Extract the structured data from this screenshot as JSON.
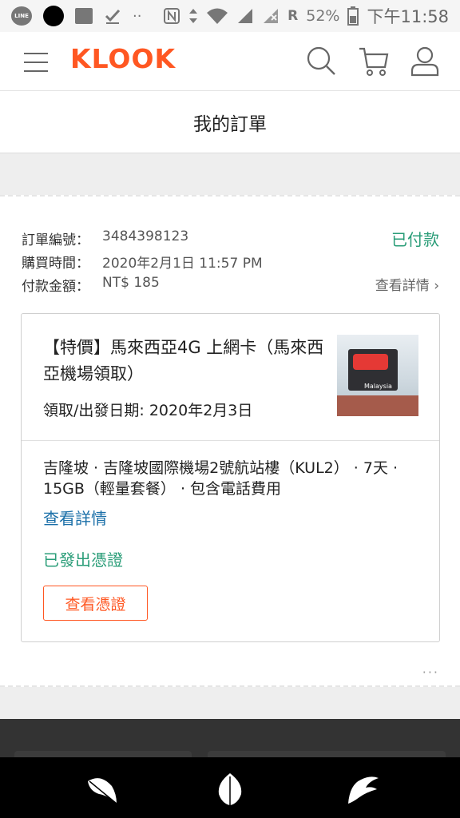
{
  "status_bar": {
    "line_label": "LINE",
    "signal_r": "R",
    "battery": "52%",
    "time": "下午11:58"
  },
  "header": {
    "logo": "KLOOK",
    "icons": [
      "menu-icon",
      "search-icon",
      "cart-icon",
      "user-icon"
    ]
  },
  "page": {
    "title": "我的訂單"
  },
  "order": {
    "number_label": "訂單編號：",
    "number": "3484398123",
    "purchase_time_label": "購買時間：",
    "purchase_time": "2020年2月1日 11:57 PM",
    "amount_label": "付款金額：",
    "amount": "NT$ 185",
    "status": "已付款",
    "view_details": "查看詳情 ›",
    "product": {
      "title": "【特價】馬來西亞4G 上網卡（馬來西亞機場領取）",
      "date": "領取/出發日期: 2020年2月3日",
      "image_tag": "Malaysia",
      "description": "吉隆坡 · 吉隆坡國際機場2號航站樓（KUL2） · 7天 · 15GB（輕量套餐） · 包含電話費用",
      "details_link": "查看詳情",
      "voucher_status": "已發出憑證",
      "voucher_button": "查看憑證"
    },
    "more_label": "···"
  },
  "colors": {
    "brand": "#ff5722",
    "paid_green": "#2a9d78",
    "link_blue": "#1a6fa8"
  }
}
